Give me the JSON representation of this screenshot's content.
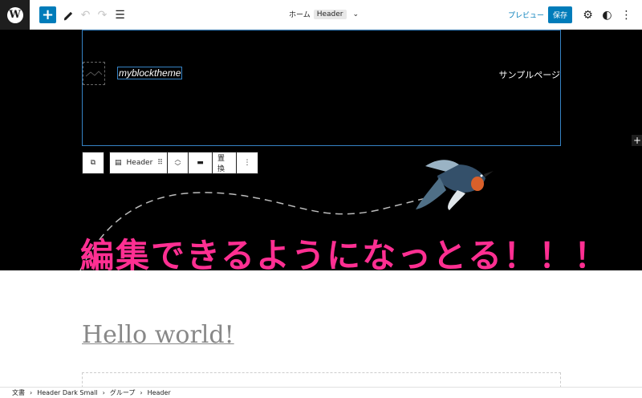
{
  "toolbar": {
    "doc_title": "ホーム",
    "doc_badge": "Header",
    "preview_label": "プレビュー",
    "save_label": "保存"
  },
  "header_block": {
    "site_title": "myblocktheme",
    "nav_item": "サンプルページ",
    "add_label": "+"
  },
  "block_toolbar": {
    "block_label": "Header",
    "replace_label": "置換"
  },
  "content": {
    "banner_text": "編集できるようになっとる！！！",
    "post_title": "Hello world!"
  },
  "breadcrumb": {
    "items": [
      "文書",
      "Header Dark Small",
      "グループ",
      "Header"
    ]
  },
  "colors": {
    "accent": "#007cba",
    "banner": "#ff2f92",
    "selection": "#3582c4"
  }
}
